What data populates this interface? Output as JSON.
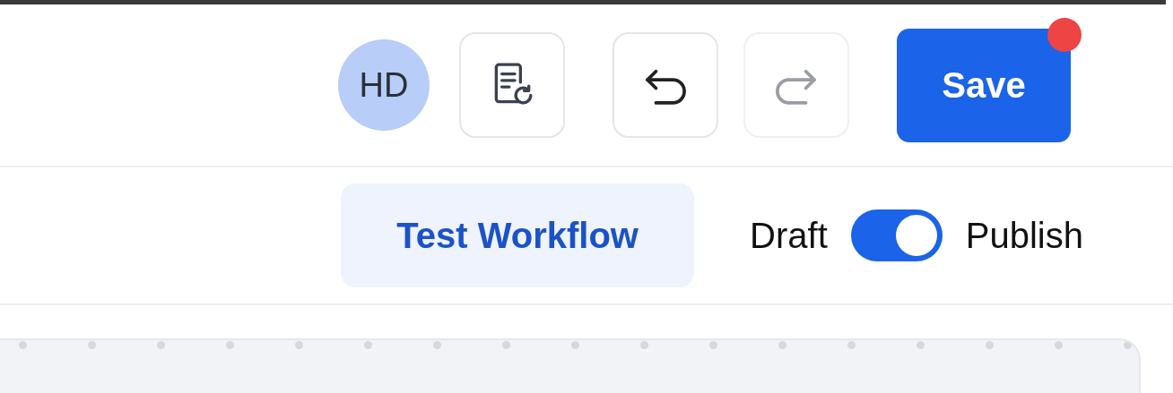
{
  "avatar": {
    "initials": "HD"
  },
  "toolbar": [
    {
      "kind": "history",
      "disabled": false
    },
    {
      "kind": "undo",
      "disabled": false
    },
    {
      "kind": "redo",
      "disabled": true
    }
  ],
  "save": {
    "label": "Save",
    "notification": true
  },
  "test_button": {
    "label": "Test Workflow"
  },
  "status_toggle": {
    "off_label": "Draft",
    "on_label": "Publish",
    "on": true
  }
}
